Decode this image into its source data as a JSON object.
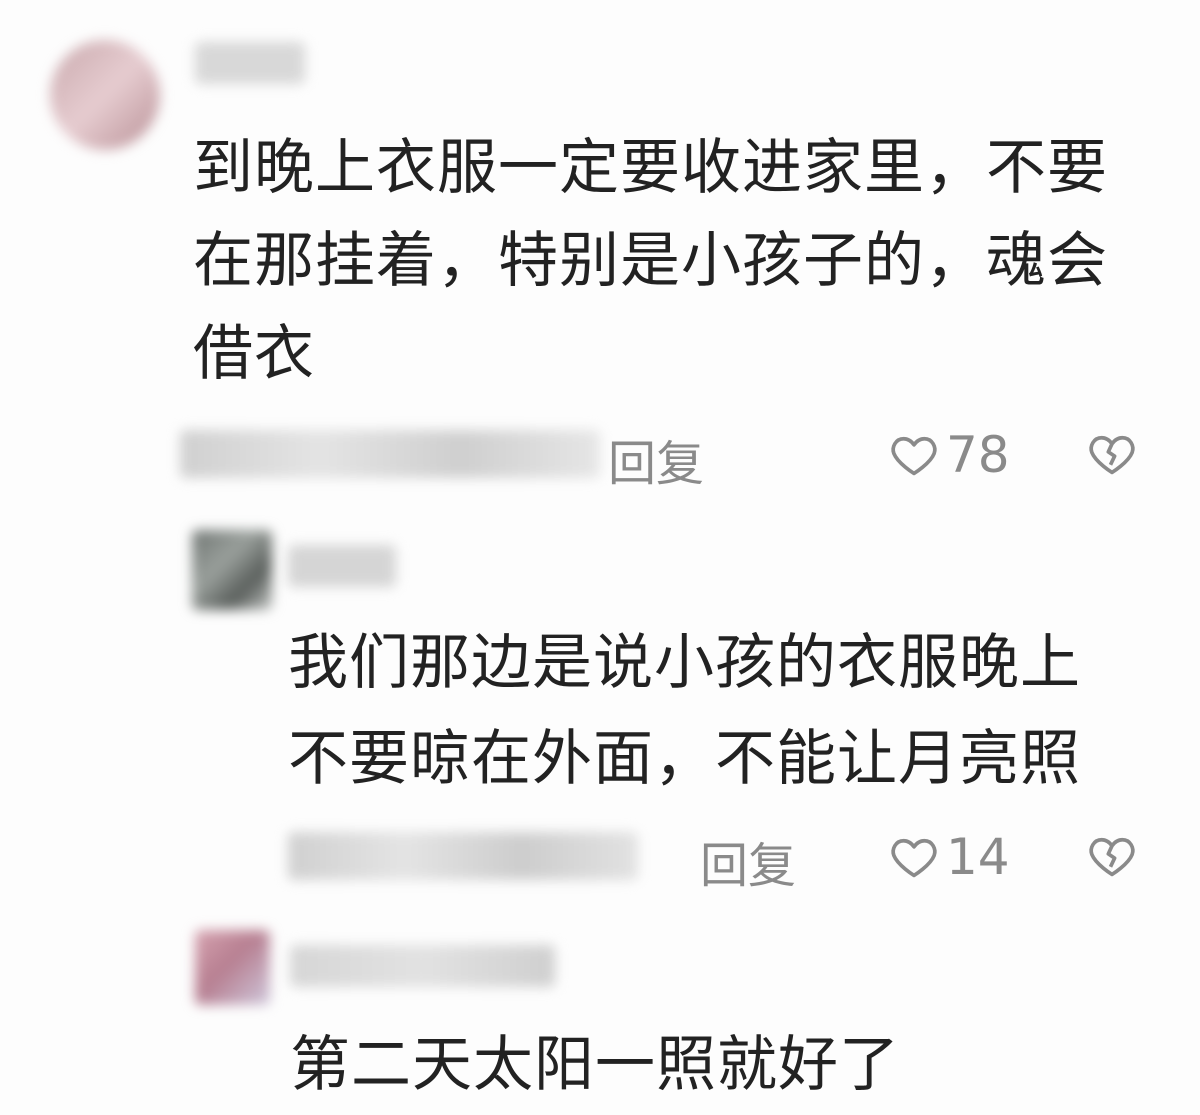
{
  "comments": [
    {
      "text_lines": [
        "到晚上衣服一定要收进家里，不要",
        "在那挂着，特别是小孩子的，魂会",
        "借衣"
      ],
      "reply_label": "回复",
      "like_count": "78"
    },
    {
      "text_lines": [
        "我们那边是说小孩的衣服晚上",
        "不要晾在外面，不能让月亮照"
      ],
      "reply_label": "回复",
      "like_count": "14"
    },
    {
      "text_lines": [
        "第二天太阳一照就好了"
      ]
    }
  ],
  "icons": {
    "like": "heart-outline-icon",
    "dislike": "broken-heart-icon"
  },
  "colors": {
    "text": "#222222",
    "meta": "#8a8a8a",
    "background": "#fdfdfd"
  }
}
